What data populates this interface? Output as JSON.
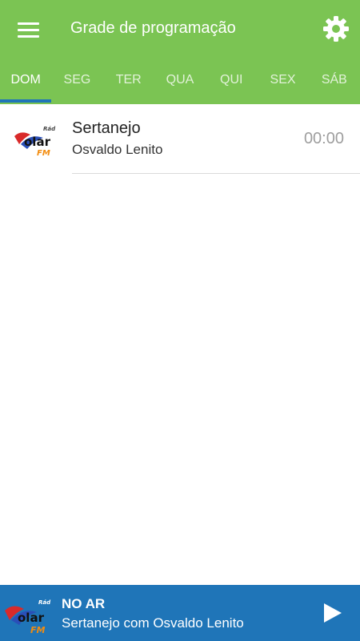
{
  "appbar": {
    "title": "Grade de programação",
    "menu_icon": "hamburger-menu-icon",
    "settings_icon": "gear-icon",
    "background": "#7bc453"
  },
  "tabs": [
    {
      "label": "DOM",
      "active": true
    },
    {
      "label": "SEG",
      "active": false
    },
    {
      "label": "TER",
      "active": false
    },
    {
      "label": "QUA",
      "active": false
    },
    {
      "label": "QUI",
      "active": false
    },
    {
      "label": "SEX",
      "active": false
    },
    {
      "label": "SÁB",
      "active": false
    }
  ],
  "schedule": [
    {
      "title": "Sertanejo",
      "host": "Osvaldo Lenito",
      "time": "00:00",
      "logo_text": "Rád Solar FM"
    }
  ],
  "player": {
    "label": "NO AR",
    "now_playing": "Sertanejo com Osvaldo Lenito",
    "logo_text": "Rád Solar FM",
    "play_icon": "play-icon",
    "background": "#1f75b8"
  },
  "colors": {
    "accent": "#1f75b8",
    "brand_green": "#7bc453"
  }
}
